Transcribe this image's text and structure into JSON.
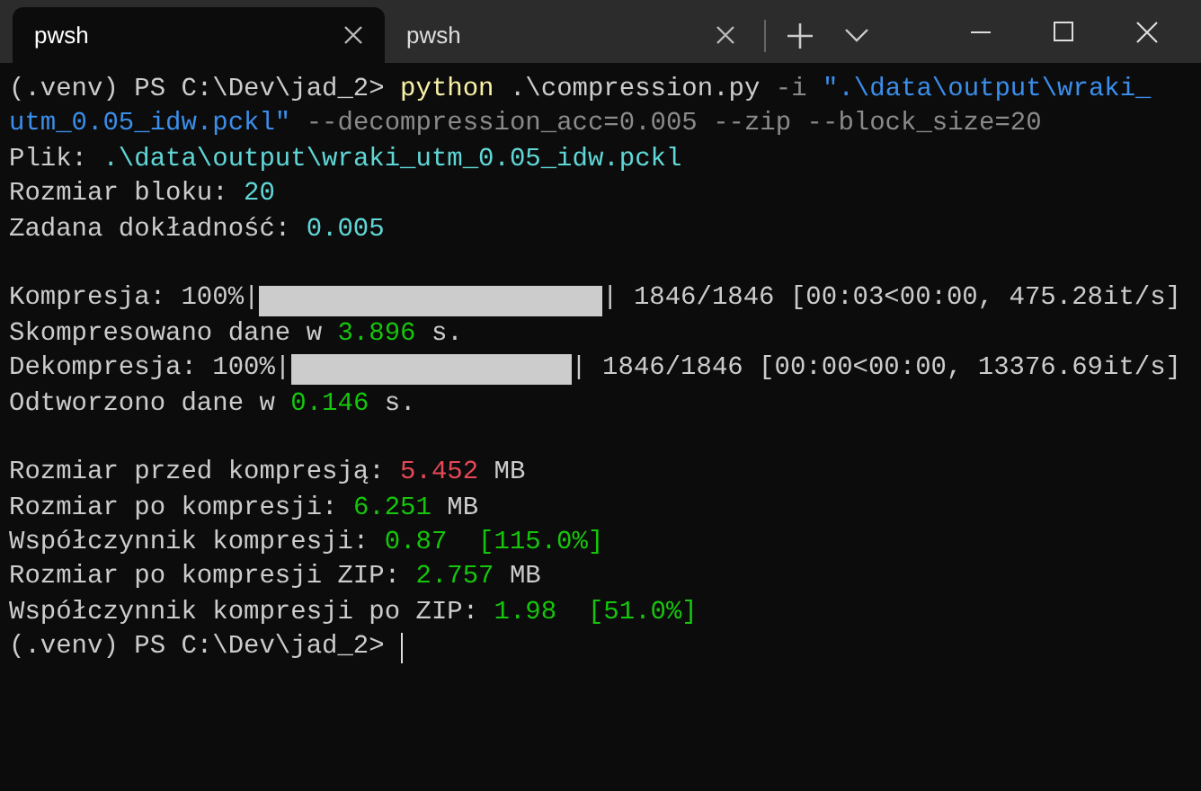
{
  "tabs": [
    {
      "title": "pwsh",
      "selected": true
    },
    {
      "title": "pwsh",
      "selected": false
    }
  ],
  "lines": [
    {
      "kind": "text",
      "segments": [
        {
          "text": "(.venv) PS C:\\Dev\\jad_2> ",
          "kind": "plain"
        },
        {
          "text": "python",
          "kind": "command"
        },
        {
          "text": " .\\compression.py ",
          "kind": "plain"
        },
        {
          "text": "-i",
          "kind": "flag"
        },
        {
          "text": " \".\\data\\output\\wraki_",
          "kind": "string"
        }
      ]
    },
    {
      "kind": "text",
      "segments": [
        {
          "text": "utm_0.05_idw.pckl\"",
          "kind": "string"
        },
        {
          "text": " --decompression_acc=0.005 --zip --block_size=20",
          "kind": "flag"
        }
      ]
    },
    {
      "kind": "text",
      "segments": [
        {
          "text": "Plik: ",
          "kind": "plain"
        },
        {
          "text": ".\\data\\output\\wraki_utm_0.05_idw.pckl",
          "kind": "path"
        }
      ]
    },
    {
      "kind": "text",
      "segments": [
        {
          "text": "Rozmiar bloku: ",
          "kind": "plain"
        },
        {
          "text": "20",
          "kind": "path"
        }
      ]
    },
    {
      "kind": "text",
      "segments": [
        {
          "text": "Zadana dokładność: ",
          "kind": "plain"
        },
        {
          "text": "0.005",
          "kind": "path"
        }
      ]
    },
    {
      "kind": "blank"
    },
    {
      "kind": "progress",
      "prefix": "Kompresja: 100%|",
      "suffix": "| 1846/1846 [00:03<00:00, 475.28it/s]",
      "level": 1
    },
    {
      "kind": "text",
      "segments": [
        {
          "text": "Skompresowano dane w ",
          "kind": "plain"
        },
        {
          "text": "3.896",
          "kind": "good"
        },
        {
          "text": " s.",
          "kind": "plain"
        }
      ]
    },
    {
      "kind": "progress",
      "prefix": "Dekompresja: 100%|",
      "suffix": "| 1846/1846 [00:00<00:00, 13376.69it/s]",
      "level": 1
    },
    {
      "kind": "text",
      "segments": [
        {
          "text": "Odtworzono dane w ",
          "kind": "plain"
        },
        {
          "text": "0.146",
          "kind": "good"
        },
        {
          "text": " s.",
          "kind": "plain"
        }
      ]
    },
    {
      "kind": "blank"
    },
    {
      "kind": "text",
      "segments": [
        {
          "text": "Rozmiar przed kompresją: ",
          "kind": "plain"
        },
        {
          "text": "5.452",
          "kind": "bad"
        },
        {
          "text": " MB",
          "kind": "plain"
        }
      ]
    },
    {
      "kind": "text",
      "segments": [
        {
          "text": "Rozmiar po kompresji: ",
          "kind": "plain"
        },
        {
          "text": "6.251",
          "kind": "good"
        },
        {
          "text": " MB",
          "kind": "plain"
        }
      ]
    },
    {
      "kind": "text",
      "segments": [
        {
          "text": "Współczynnik kompresji: ",
          "kind": "plain"
        },
        {
          "text": "0.87  [115.0%]",
          "kind": "good"
        }
      ]
    },
    {
      "kind": "text",
      "segments": [
        {
          "text": "Rozmiar po kompresji ZIP: ",
          "kind": "plain"
        },
        {
          "text": "2.757",
          "kind": "good"
        },
        {
          "text": " MB",
          "kind": "plain"
        }
      ]
    },
    {
      "kind": "text",
      "segments": [
        {
          "text": "Współczynnik kompresji po ZIP: ",
          "kind": "plain"
        },
        {
          "text": "1.98  [51.0%]",
          "kind": "good"
        }
      ]
    },
    {
      "kind": "prompt",
      "text": "(.venv) PS C:\\Dev\\jad_2> "
    }
  ]
}
